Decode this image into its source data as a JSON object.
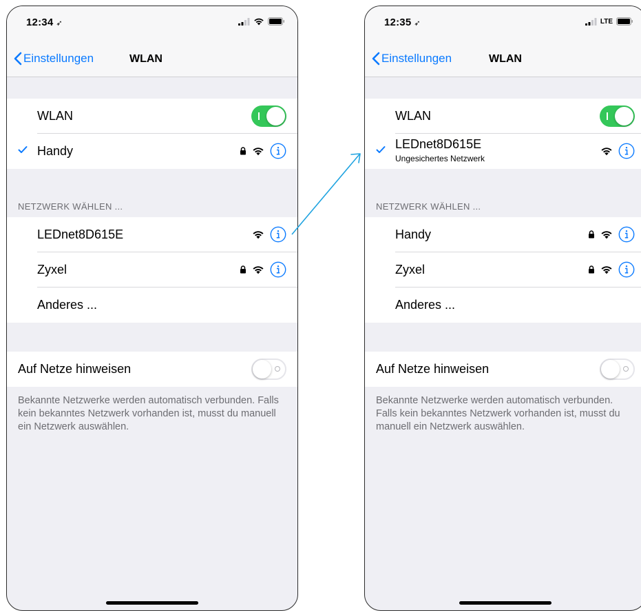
{
  "colors": {
    "accent": "#0a7aff",
    "toggle_on": "#34c759",
    "background": "#efeff4"
  },
  "screens": [
    {
      "status": {
        "time": "12:34",
        "network_label": ""
      },
      "nav": {
        "back": "Einstellungen",
        "title": "WLAN"
      },
      "wlan_row": {
        "label": "WLAN",
        "toggle": "on"
      },
      "connected": {
        "name": "Handy",
        "subtitle": "",
        "lock": true,
        "icon": "wifi-icon"
      },
      "section_header": "NETZWERK WÄHLEN ...",
      "networks": [
        {
          "name": "LEDnet8D615E",
          "lock": false
        },
        {
          "name": "Zyxel",
          "lock": true
        },
        {
          "name": "Anderes ...",
          "other": true
        }
      ],
      "notify_row": {
        "label": "Auf Netze hinweisen",
        "toggle": "off"
      },
      "footer": "Bekannte Netzwerke werden automatisch verbunden. Falls kein bekanntes Netzwerk vorhanden ist, musst du manuell ein Netzwerk auswählen."
    },
    {
      "status": {
        "time": "12:35",
        "network_label": "LTE"
      },
      "nav": {
        "back": "Einstellungen",
        "title": "WLAN"
      },
      "wlan_row": {
        "label": "WLAN",
        "toggle": "on"
      },
      "connected": {
        "name": "LEDnet8D615E",
        "subtitle": "Ungesichertes Netzwerk",
        "lock": false,
        "icon": "wifi-icon"
      },
      "section_header": "NETZWERK WÄHLEN ...",
      "networks": [
        {
          "name": "Handy",
          "lock": true
        },
        {
          "name": "Zyxel",
          "lock": true
        },
        {
          "name": "Anderes ...",
          "other": true
        }
      ],
      "notify_row": {
        "label": "Auf Netze hinweisen",
        "toggle": "off"
      },
      "footer": "Bekannte Netzwerke werden automatisch verbunden. Falls kein bekanntes Netzwerk vorhanden ist, musst du manuell ein Netzwerk auswählen."
    }
  ]
}
